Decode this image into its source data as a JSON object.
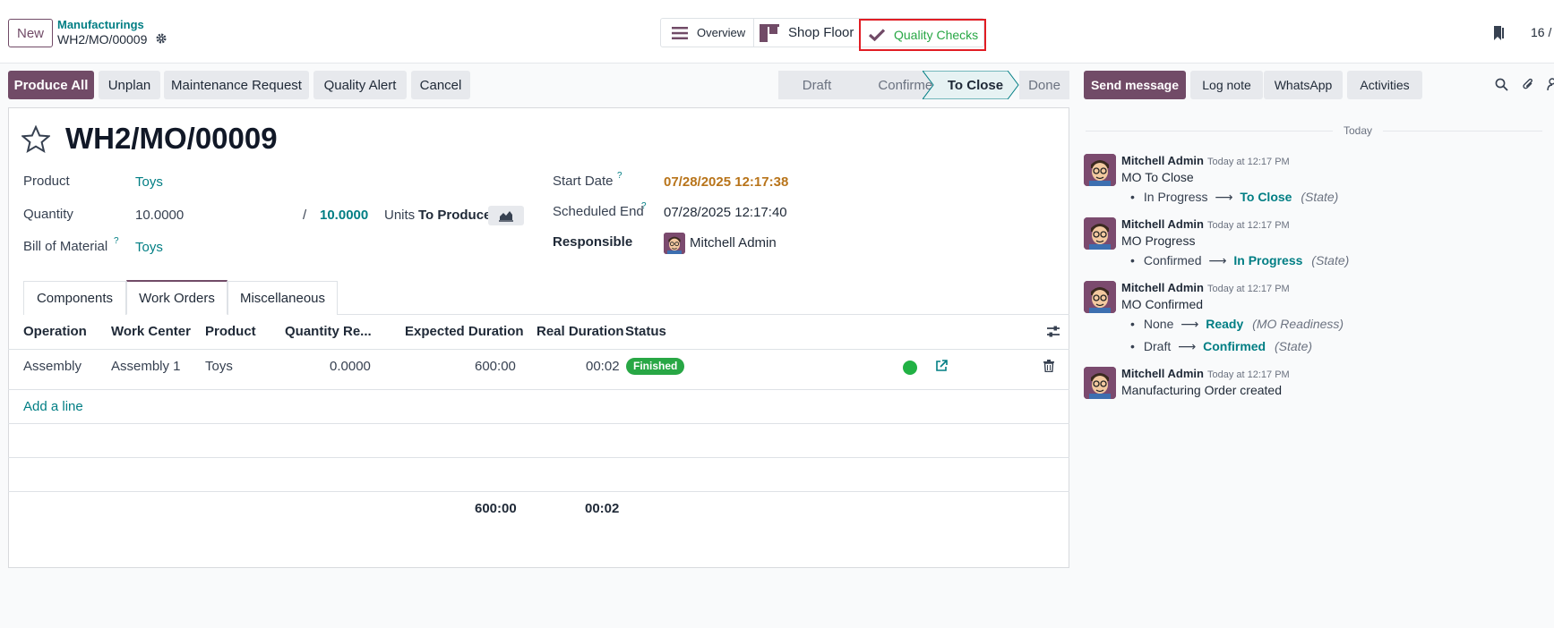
{
  "header": {
    "new_label": "New",
    "breadcrumb_parent": "Manufacturings",
    "record_name": "WH2/MO/00009",
    "smart_buttons": {
      "overview": "Overview",
      "shop_floor": "Shop Floor",
      "quality_checks": "Quality Checks"
    },
    "pager": "16 /"
  },
  "actions": {
    "produce_all": "Produce All",
    "unplan": "Unplan",
    "maintenance_request": "Maintenance Request",
    "quality_alert": "Quality Alert",
    "cancel": "Cancel"
  },
  "statusbar": {
    "stages": [
      "Draft",
      "Confirmed",
      "To Close",
      "Done"
    ],
    "current": "To Close"
  },
  "form": {
    "title": "WH2/MO/00009",
    "product_label": "Product",
    "product_value": "Toys",
    "quantity_label": "Quantity",
    "quantity_value": "10.0000",
    "quantity_separator": "/",
    "quantity_to_produce": "10.0000",
    "units_label": "Units",
    "to_produce_label": "To Produce",
    "bom_label": "Bill of Material",
    "bom_value": "Toys",
    "start_date_label": "Start Date",
    "start_date_value": "07/28/2025 12:17:38",
    "scheduled_end_label": "Scheduled End",
    "scheduled_end_value": "07/28/2025 12:17:40",
    "responsible_label": "Responsible",
    "responsible_value": "Mitchell Admin",
    "help_mark": "?"
  },
  "tabs": {
    "components": "Components",
    "work_orders": "Work Orders",
    "miscellaneous": "Miscellaneous",
    "active": "Work Orders"
  },
  "table": {
    "headers": {
      "operation": "Operation",
      "work_center": "Work Center",
      "product": "Product",
      "quantity": "Quantity Re...",
      "expected": "Expected Duration",
      "real": "Real Duration",
      "status": "Status"
    },
    "row": {
      "operation": "Assembly",
      "work_center": "Assembly 1",
      "product": "Toys",
      "quantity": "0.0000",
      "expected": "600:00",
      "real": "00:02",
      "status": "Finished"
    },
    "add_line": "Add a line",
    "totals": {
      "expected": "600:00",
      "real": "00:02"
    }
  },
  "chatter": {
    "send_message": "Send message",
    "log_note": "Log note",
    "whatsapp": "WhatsApp",
    "activities": "Activities",
    "today": "Today",
    "arrow": "⟶",
    "messages": [
      {
        "author": "Mitchell Admin",
        "time": "Today at 12:17 PM",
        "body": "MO To Close",
        "changes": [
          {
            "old": "In Progress",
            "new": "To Close",
            "field": "(State)"
          }
        ]
      },
      {
        "author": "Mitchell Admin",
        "time": "Today at 12:17 PM",
        "body": "MO Progress",
        "changes": [
          {
            "old": "Confirmed",
            "new": "In Progress",
            "field": "(State)"
          }
        ]
      },
      {
        "author": "Mitchell Admin",
        "time": "Today at 12:17 PM",
        "body": "MO Confirmed",
        "changes": [
          {
            "old": "None",
            "new": "Ready",
            "field": "(MO Readiness)"
          },
          {
            "old": "Draft",
            "new": "Confirmed",
            "field": "(State)"
          }
        ]
      },
      {
        "author": "Mitchell Admin",
        "time": "Today at 12:17 PM",
        "body": "Manufacturing Order created",
        "changes": []
      }
    ]
  },
  "colors": {
    "primary": "#714b67",
    "link": "#017e84",
    "success": "#28a745",
    "date_warning": "#b8741a",
    "highlight_box": "#e11d24"
  }
}
